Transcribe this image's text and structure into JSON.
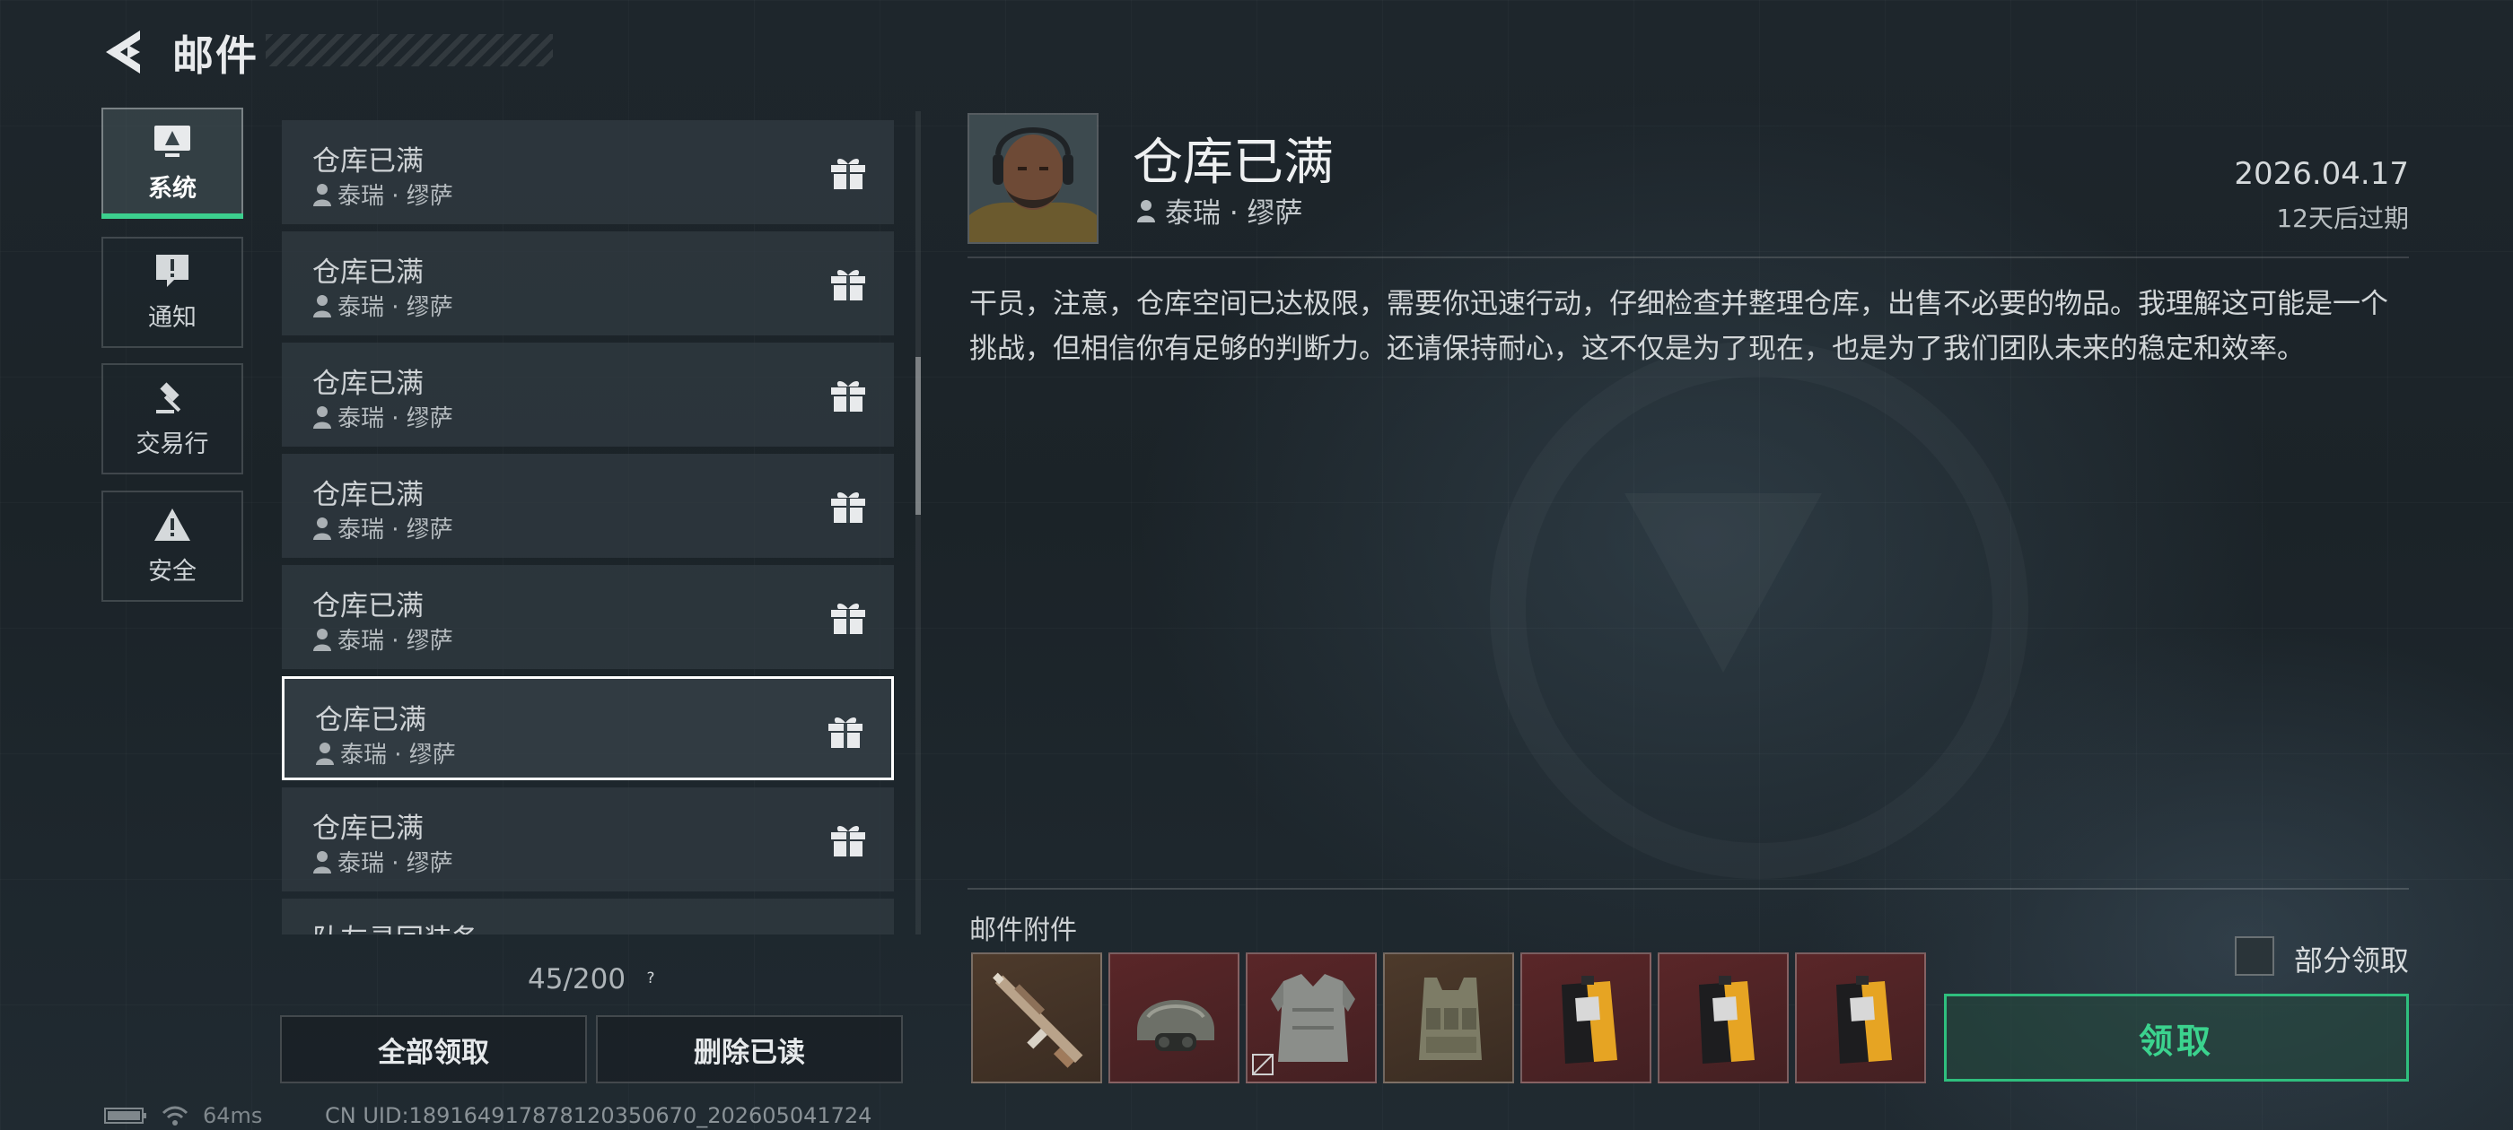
{
  "header": {
    "title": "邮件",
    "back_icon": "back-arrow-icon"
  },
  "categories": [
    {
      "label": "系统",
      "icon": "monitor-alert-icon",
      "active": true
    },
    {
      "label": "通知",
      "icon": "message-alert-icon",
      "active": false
    },
    {
      "label": "交易行",
      "icon": "gavel-icon",
      "active": false
    },
    {
      "label": "安全",
      "icon": "warning-triangle-icon",
      "active": false
    }
  ],
  "mail_list": {
    "items": [
      {
        "subject": "仓库已满",
        "sender": "泰瑞 · 缪萨",
        "icon": "gift-icon"
      },
      {
        "subject": "仓库已满",
        "sender": "泰瑞 · 缪萨",
        "icon": "gift-icon"
      },
      {
        "subject": "仓库已满",
        "sender": "泰瑞 · 缪萨",
        "icon": "gift-icon"
      },
      {
        "subject": "仓库已满",
        "sender": "泰瑞 · 缪萨",
        "icon": "gift-icon"
      },
      {
        "subject": "仓库已满",
        "sender": "泰瑞 · 缪萨",
        "icon": "gift-icon"
      },
      {
        "subject": "仓库已满",
        "sender": "泰瑞 · 缪萨",
        "icon": "gift-icon"
      },
      {
        "subject": "仓库已满",
        "sender": "泰瑞 · 缪萨",
        "icon": "gift-icon"
      },
      {
        "subject": "队友寻回装备",
        "sender": "",
        "icon": ""
      }
    ],
    "selected_index": 5,
    "count": "45/200",
    "help": "?"
  },
  "actions": {
    "claim_all": "全部领取",
    "delete_read": "删除已读"
  },
  "status_bar": {
    "ping": "64ms",
    "uid": "CN UID:18916491787812035067​0_202605041724"
  },
  "detail": {
    "title": "仓库已满",
    "sender": "泰瑞 · 缪萨",
    "date": "2026.04.17",
    "expire": "12天后过期",
    "body": "干员，注意，仓库空间已达极限，需要你迅速行动，仔细检查并整理仓库，出售不必要的物品。我理解这可能是一个挑战，但相信你有足够的判断力。还请保持耐心，这不仅是为了现在，也是为了我们团队未来的稳定和效率。",
    "attachments_label": "邮件附件",
    "attachments": [
      {
        "item": "rifle",
        "rarity": "brown"
      },
      {
        "item": "helmet",
        "rarity": "red"
      },
      {
        "item": "body-armor",
        "rarity": "red"
      },
      {
        "item": "chest-rig",
        "rarity": "brown"
      },
      {
        "item": "supply-bag",
        "rarity": "red"
      },
      {
        "item": "supply-bag",
        "rarity": "red"
      },
      {
        "item": "supply-bag",
        "rarity": "red"
      }
    ],
    "partial_claim_label": "部分领取",
    "claim_label": "领取",
    "accent_color": "#3bd38e"
  }
}
